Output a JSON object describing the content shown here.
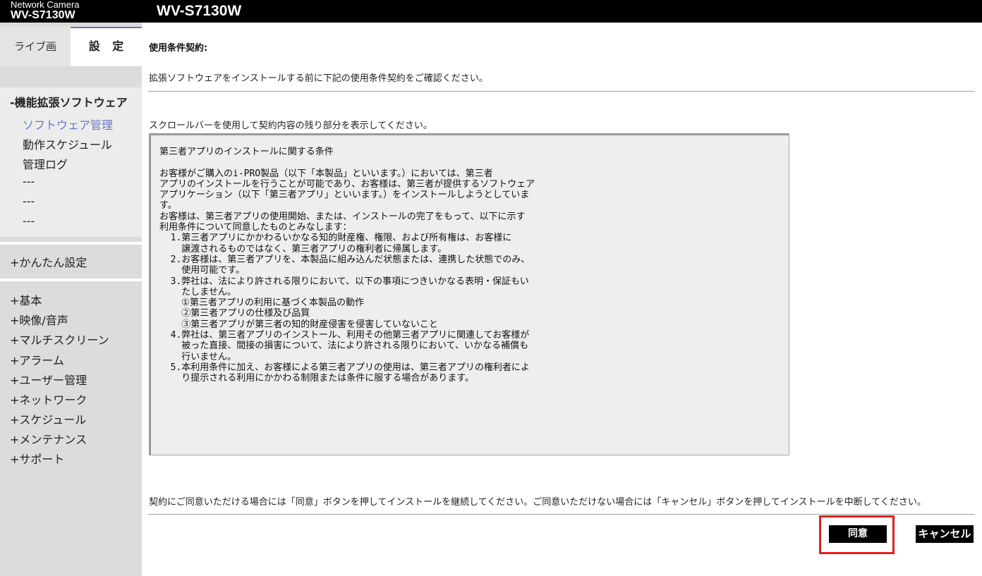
{
  "header": {
    "brand_small": "Network Camera",
    "brand_model": "WV-S7130W",
    "title": "WV-S7130W"
  },
  "sidebar": {
    "tab_live": "ライブ画",
    "tab_setup": "設 定",
    "group_title": "-機能拡張ソフトウェア",
    "sub_items": [
      "ソフトウェア管理",
      "動作スケジュール",
      "管理ログ",
      "---",
      "---",
      "---"
    ],
    "easy_setup": "+かんたん設定",
    "menu": [
      "+基本",
      "+映像/音声",
      "+マルチスクリーン",
      "+アラーム",
      "+ユーザー管理",
      "+ネットワーク",
      "+スケジュール",
      "+メンテナンス",
      "+サポート"
    ]
  },
  "main": {
    "heading": "使用条件契約:",
    "intro": "拡張ソフトウェアをインストールする前に下記の使用条件契約をご確認ください。",
    "scroll_note": "スクロールバーを使用して契約内容の残り部分を表示してください。",
    "terms": "第三者アプリのインストールに関する条件\n\nお客様がご購入のi-PRO製品（以下「本製品」といいます。）においては、第三者\nアプリのインストールを行うことが可能であり、お客様は、第三者が提供するソフトウェア\nアプリケーション（以下「第三者アプリ」といいます。）をインストールしようとしていま\nす。\nお客様は、第三者アプリの使用開始、または、インストールの完了をもって、以下に示す\n利用条件について同意したものとみなします：\n  1.第三者アプリにかかわるいかなる知的財産権、権限、および所有権は、お客様に\n    譲渡されるものではなく、第三者アプリの権利者に帰属します。\n  2.お客様は、第三者アプリを、本製品に組み込んだ状態または、連携した状態でのみ、\n    使用可能です。\n  3.弊社は、法により許される限りにおいて、以下の事項につきいかなる表明・保証もい\n    たしません。\n    ①第三者アプリの利用に基づく本製品の動作\n    ②第三者アプリの仕様及び品質\n    ③第三者アプリが第三者の知的財産侵害を侵害していないこと\n  4.弊社は、第三者アプリのインストール、利用その他第三者アプリに関連してお客様が\n    被った直接、間接の損害について、法により許される限りにおいて、いかなる補償も\n    行いません。\n  5.本利用条件に加え、お客様による第三者アプリの使用は、第三者アプリの権利者によ\n    り提示される利用にかかわる制限または条件に服する場合があります。",
    "bottom_note": "契約にご同意いただける場合には「同意」ボタンを押してインストールを継続してください。ご同意いただけない場合には「キャンセル」ボタンを押してインストールを中断してください。",
    "agree_label": "同意",
    "cancel_label": "キャンセル"
  },
  "colors": {
    "header_bg": "#000000",
    "sidebar_bg": "#dcdcdc",
    "active_link": "#6b77c0",
    "highlight_frame": "#e02020",
    "terms_bg": "#eeeeee"
  }
}
